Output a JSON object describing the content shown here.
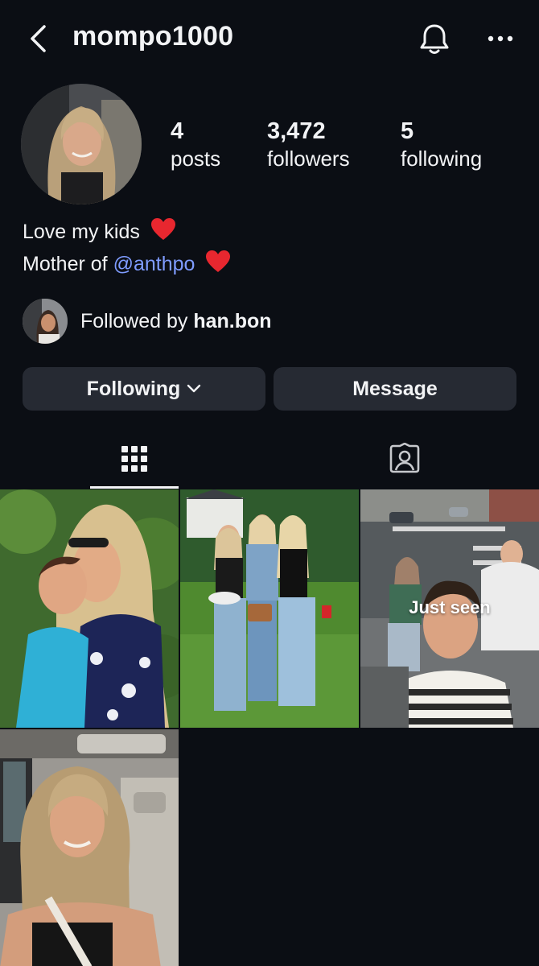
{
  "header": {
    "username": "mompo1000",
    "icons": [
      "back-arrow-icon",
      "bell-icon",
      "more-icon"
    ]
  },
  "profile": {
    "stats": [
      {
        "value": "4",
        "label": "posts"
      },
      {
        "value": "3,472",
        "label": "followers"
      },
      {
        "value": "5",
        "label": "following"
      }
    ],
    "bio_line1": "Love my kids",
    "bio_line2_prefix": "Mother of",
    "bio_mention": "@anthpo",
    "followed_by_prefix": "Followed by",
    "followed_by_user": "han.bon"
  },
  "actions": {
    "following_label": "Following",
    "message_label": "Message"
  },
  "tabs": [
    {
      "name": "posts-grid",
      "icon": "grid-icon",
      "active": true
    },
    {
      "name": "tagged",
      "icon": "tagged-person-icon",
      "active": false
    }
  ],
  "posts": [
    {
      "overlay": ""
    },
    {
      "overlay": ""
    },
    {
      "overlay": "Just seen"
    },
    {
      "overlay": ""
    }
  ],
  "colors": {
    "background": "#0b0e14",
    "button": "#262a33",
    "mention": "#7f9cff",
    "heart": "#e8272f"
  }
}
